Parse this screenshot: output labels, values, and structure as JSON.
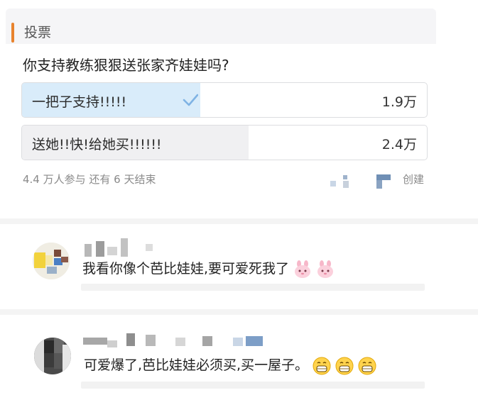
{
  "poll": {
    "header_title": "投票",
    "question": "你支持教练狠狠送张家齐娃娃吗?",
    "options": [
      {
        "label": "一把子支持!!!!!",
        "count": "1.9万",
        "selected": true,
        "fill_fraction": 0.44
      },
      {
        "label": "送她!!快!给她买!!!!!!",
        "count": "2.4万",
        "selected": false,
        "fill_fraction": 0.56
      }
    ],
    "meta": "4.4 万人参与   还有 6 天结束",
    "creator_suffix": "创建"
  },
  "comments": [
    {
      "text": "我看你像个芭比娃娃,要可爱死我了",
      "emojis": [
        "pink-bunny-emoji",
        "pink-bunny-emoji"
      ]
    },
    {
      "text": "可爱爆了,芭比娃娃必须买,买一屋子。",
      "emojis": [
        "grin-emoji",
        "grin-emoji",
        "grin-emoji"
      ]
    }
  ],
  "colors": {
    "accent": "#e8832e",
    "selected_fill": "#d9ecfa",
    "check": "#7fb3e4"
  }
}
